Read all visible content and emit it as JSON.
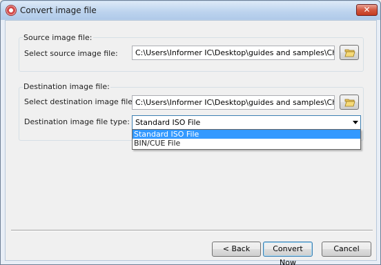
{
  "window": {
    "title": "Convert image file",
    "close_symbol": "✕"
  },
  "source": {
    "group_label": "Source image file:",
    "field_label": "Select source image file:",
    "path_value": "C:\\Users\\Informer IC\\Desktop\\guides and samples\\Church on..."
  },
  "destination": {
    "group_label": "Destination image file:",
    "field_label": "Select destination image file:",
    "path_value": "C:\\Users\\Informer IC\\Desktop\\guides and samples\\Church on...",
    "type_label": "Destination image file type:",
    "type_selected": "Standard ISO File",
    "type_options": [
      "Standard ISO File",
      "BIN/CUE File"
    ]
  },
  "buttons": {
    "back": "< Back",
    "convert": "Convert Now",
    "cancel": "Cancel"
  },
  "icons": {
    "folder": "folder-open-icon"
  }
}
